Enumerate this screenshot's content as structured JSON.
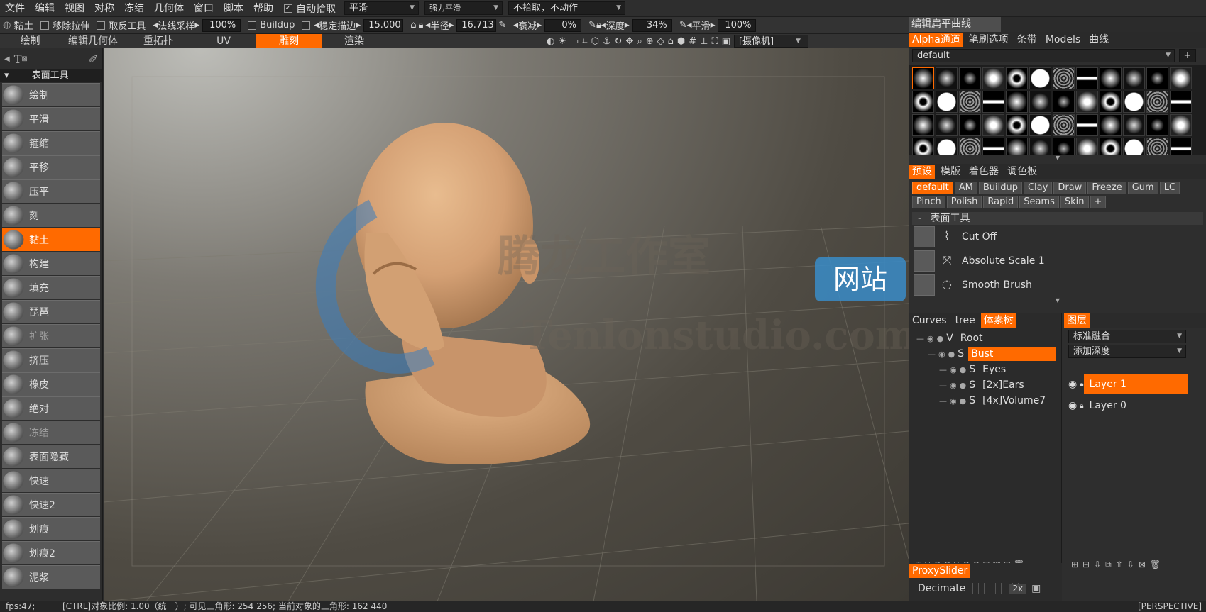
{
  "menu": [
    "文件",
    "编辑",
    "视图",
    "对称",
    "冻结",
    "几何体",
    "窗口",
    "脚本",
    "帮助"
  ],
  "menu_right": {
    "autopick_label": "自动拾取",
    "smooth_mode": "平滑",
    "strong_smooth": "强力平滑",
    "no_pick": "不拾取，不动作"
  },
  "tool_options": {
    "tool_name": "黏土",
    "remove_stretch": "移除拉伸",
    "invert_tool": "取反工具",
    "normal_sampling_label": "法线采样",
    "normal_sampling_value": "100%",
    "buildup": "Buildup",
    "stabilize_label": "稳定描边",
    "stabilize_value": "15.000",
    "radius_label": "半径",
    "radius_value": "16.713",
    "falloff_label": "衰减",
    "falloff_value": "0%",
    "depth_label": "深度",
    "depth_value": "34%",
    "smooth_label": "平滑",
    "smooth_value": "100%",
    "edit_curve": "编辑扁平曲线"
  },
  "room_tabs": [
    "绘制",
    "编辑几何体",
    "重拓扑",
    "UV",
    "雕刻",
    "渲染"
  ],
  "active_room": "雕刻",
  "camera_select": "[摄像机]",
  "left_panel": {
    "section_title": "表面工具",
    "tools": [
      {
        "label": "绘制",
        "state": "normal"
      },
      {
        "label": "平滑",
        "state": "normal"
      },
      {
        "label": "箍缩",
        "state": "normal"
      },
      {
        "label": "平移",
        "state": "normal"
      },
      {
        "label": "压平",
        "state": "normal"
      },
      {
        "label": "刻",
        "state": "normal"
      },
      {
        "label": "黏土",
        "state": "active"
      },
      {
        "label": "构建",
        "state": "normal"
      },
      {
        "label": "填充",
        "state": "normal"
      },
      {
        "label": "琵琶",
        "state": "normal"
      },
      {
        "label": "扩张",
        "state": "dim"
      },
      {
        "label": "挤压",
        "state": "normal"
      },
      {
        "label": "橡皮",
        "state": "normal"
      },
      {
        "label": "绝对",
        "state": "normal"
      },
      {
        "label": "冻结",
        "state": "dim"
      },
      {
        "label": "表面隐藏",
        "state": "normal"
      },
      {
        "label": "快速",
        "state": "normal"
      },
      {
        "label": "快速2",
        "state": "normal"
      },
      {
        "label": "划痕",
        "state": "normal"
      },
      {
        "label": "划痕2",
        "state": "normal"
      },
      {
        "label": "泥浆",
        "state": "normal"
      }
    ]
  },
  "watermark": {
    "cn": "腾龙工作室",
    "badge": "网站",
    "en": "Tenlonstudio.com"
  },
  "right_top_tabs": [
    "Alpha通道",
    "笔刷选项",
    "条带",
    "Models",
    "曲线"
  ],
  "alpha_preset": "default",
  "preset_tabs": [
    "预设",
    "模版",
    "着色器",
    "调色板"
  ],
  "preset_chips": [
    "default",
    "AM",
    "Buildup",
    "Clay",
    "Draw",
    "Freeze",
    "Gum",
    "LC",
    "Pinch",
    "Polish",
    "Rapid",
    "Seams",
    "Skin"
  ],
  "preset_section": "表面工具",
  "brushes": [
    "Cut Off",
    "Absolute Scale 1",
    "Smooth Brush"
  ],
  "tree_tabs": [
    "Curves",
    "tree",
    "体素树"
  ],
  "tree": [
    {
      "flag": "V",
      "name": "Root",
      "level": 0,
      "active": false
    },
    {
      "flag": "S",
      "name": "Bust",
      "level": 1,
      "active": true
    },
    {
      "flag": "S",
      "name": "Eyes",
      "level": 2,
      "active": false
    },
    {
      "flag": "S",
      "name": "[2x]Ears",
      "level": 2,
      "active": false
    },
    {
      "flag": "S",
      "name": "[4x]Volume7",
      "level": 2,
      "active": false
    }
  ],
  "layers_tab": "图层",
  "blend_mode": "标准融合",
  "add_depth": "添加深度",
  "layers": [
    {
      "name": "Layer  1",
      "active": true
    },
    {
      "name": "Layer  0",
      "active": false
    }
  ],
  "proxy": {
    "tab": "ProxySlider",
    "label": "Decimate",
    "value": "2x"
  },
  "status": {
    "fps": "fps:47;",
    "info": "[CTRL]对象比例: 1.00（统一）; 可见三角形: 254  256; 当前对象的三角形: 162  440",
    "view": "[PERSPECTIVE]"
  },
  "colors": {
    "accent": "#ff6a00",
    "skin": "#d9a778",
    "watermark_blue": "#3a7fc0"
  }
}
